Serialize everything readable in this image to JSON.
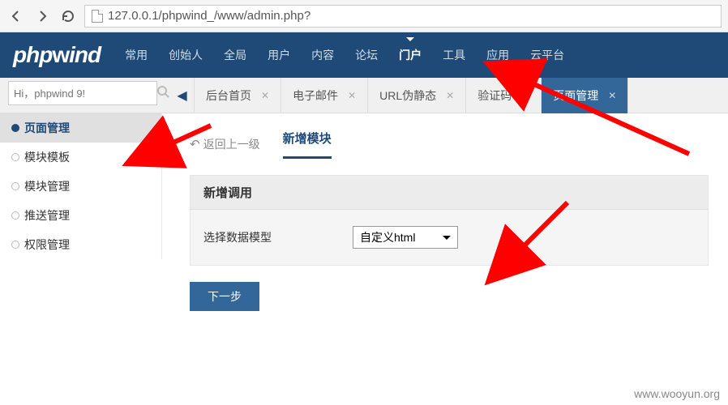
{
  "browser": {
    "url": "127.0.0.1/phpwind_/www/admin.php?"
  },
  "logo": "phpwind",
  "topnav": [
    {
      "label": "常用"
    },
    {
      "label": "创始人"
    },
    {
      "label": "全局"
    },
    {
      "label": "用户"
    },
    {
      "label": "内容"
    },
    {
      "label": "论坛"
    },
    {
      "label": "门户",
      "active": true
    },
    {
      "label": "工具"
    },
    {
      "label": "应用"
    },
    {
      "label": "云平台"
    }
  ],
  "search_placeholder": "Hi，phpwind 9!",
  "tabs": [
    {
      "label": "后台首页"
    },
    {
      "label": "电子邮件"
    },
    {
      "label": "URL伪静态"
    },
    {
      "label": "验证码"
    },
    {
      "label": "页面管理",
      "active": true
    }
  ],
  "sidebar": [
    {
      "label": "页面管理",
      "active": true
    },
    {
      "label": "模块模板"
    },
    {
      "label": "模块管理"
    },
    {
      "label": "推送管理"
    },
    {
      "label": "权限管理"
    }
  ],
  "main": {
    "back": "返回上一级",
    "title": "新增模块",
    "panel_header": "新增调用",
    "field_label": "选择数据模型",
    "select_value": "自定义html",
    "submit": "下一步"
  },
  "watermark": "www.wooyun.org"
}
